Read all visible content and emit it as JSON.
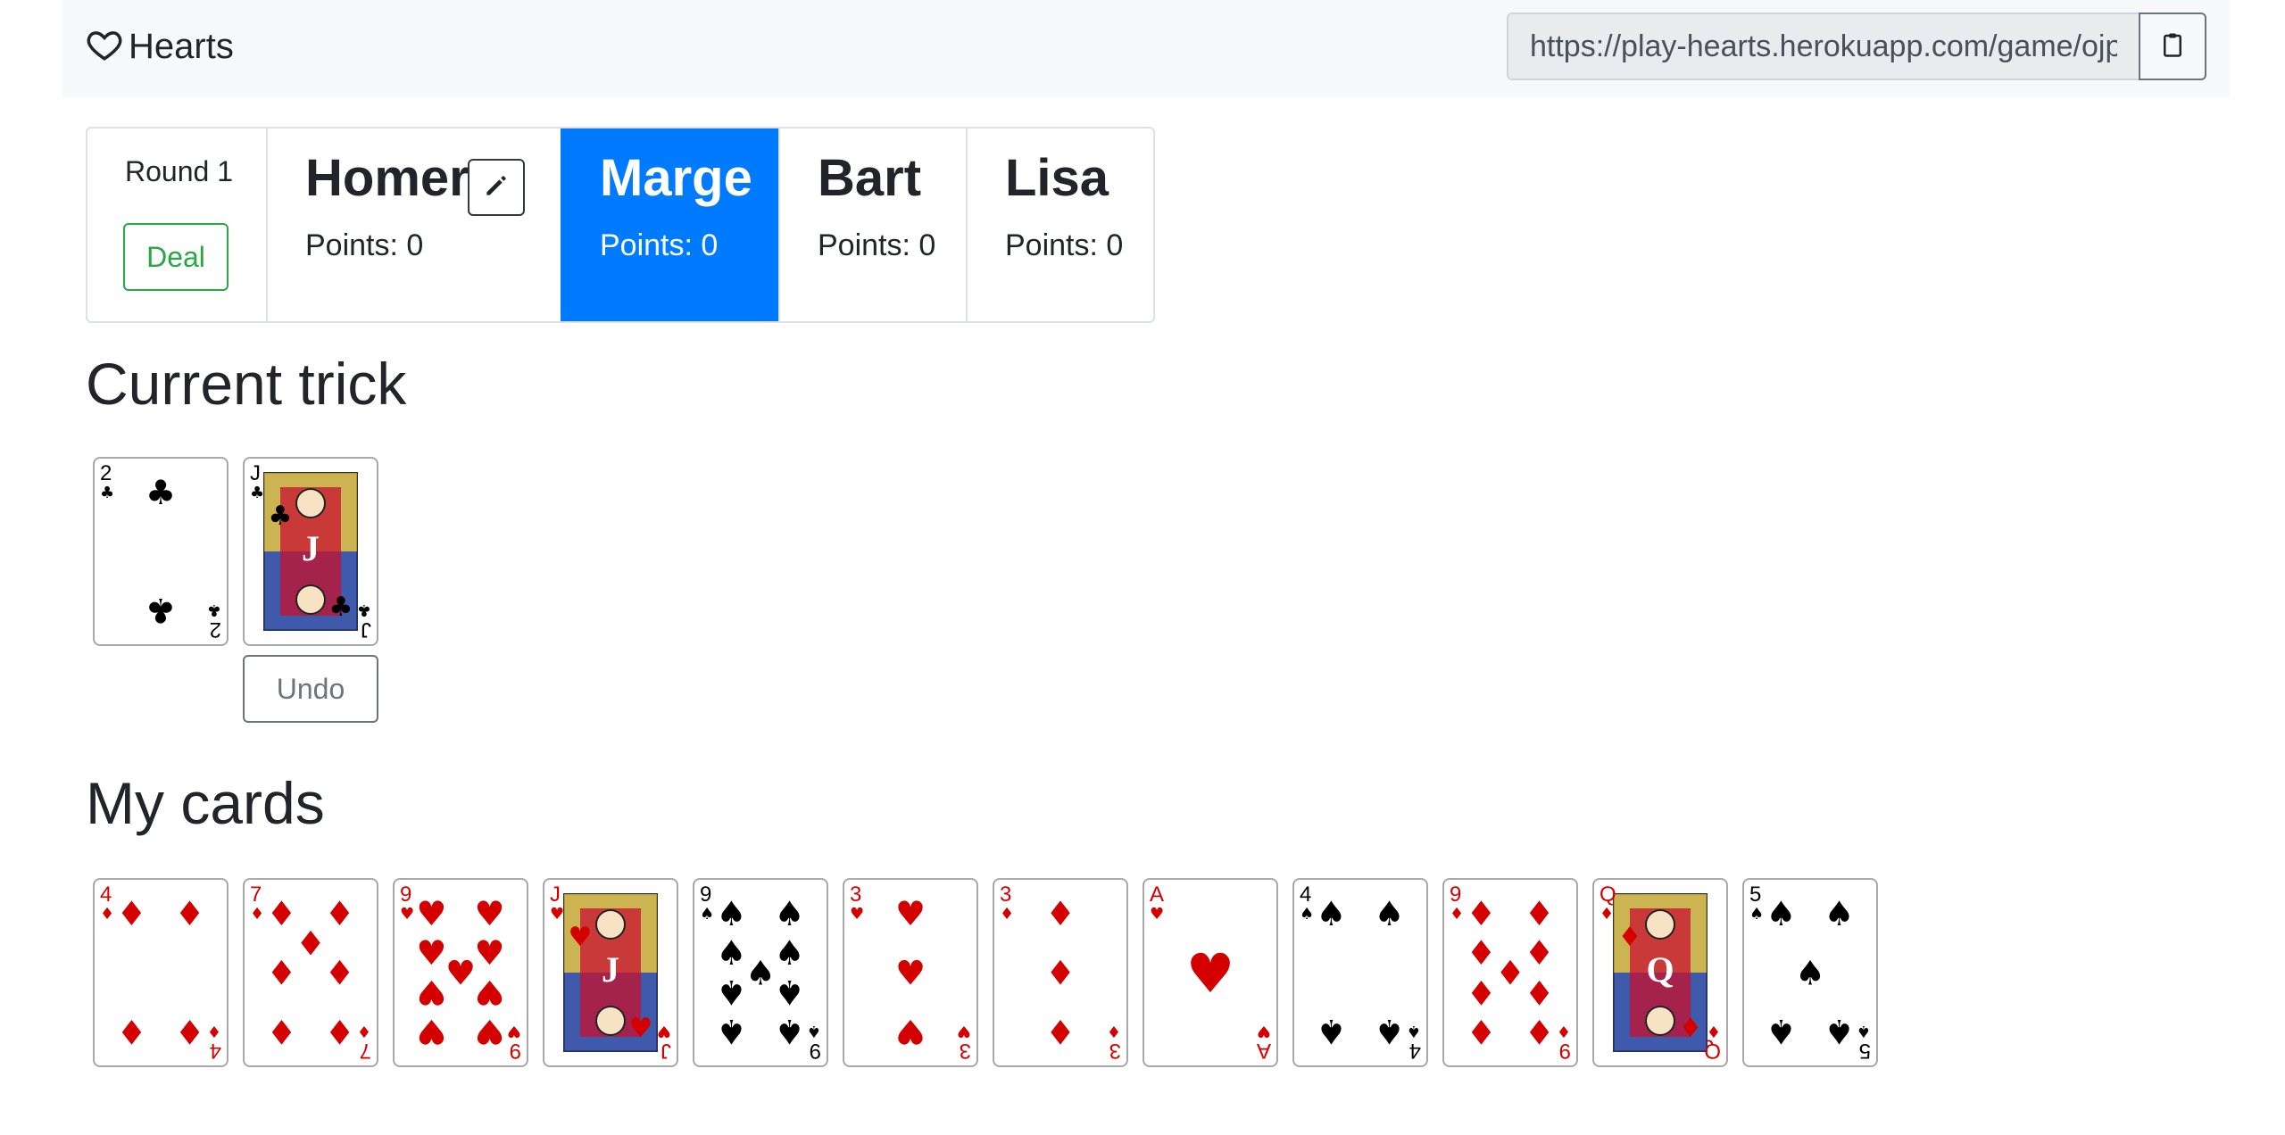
{
  "navbar": {
    "brand": "Hearts",
    "url": "https://play-hearts.herokuapp.com/game/ojp"
  },
  "scoreboard": {
    "round_label": "Round 1",
    "deal_label": "Deal",
    "active_player": "Marge",
    "players": [
      {
        "name": "Homer",
        "points": "Points: 0"
      },
      {
        "name": "Marge",
        "points": "Points: 0"
      },
      {
        "name": "Bart",
        "points": "Points: 0"
      },
      {
        "name": "Lisa",
        "points": "Points: 0"
      }
    ]
  },
  "trick": {
    "heading": "Current trick",
    "undo_label": "Undo",
    "cards": [
      {
        "rank": "2",
        "suit": "clubs"
      },
      {
        "rank": "J",
        "suit": "clubs"
      }
    ]
  },
  "hand": {
    "heading": "My cards",
    "cards": [
      {
        "rank": "4",
        "suit": "diamonds"
      },
      {
        "rank": "7",
        "suit": "diamonds"
      },
      {
        "rank": "9",
        "suit": "hearts"
      },
      {
        "rank": "J",
        "suit": "hearts"
      },
      {
        "rank": "9",
        "suit": "spades"
      },
      {
        "rank": "3",
        "suit": "hearts"
      },
      {
        "rank": "3",
        "suit": "diamonds"
      },
      {
        "rank": "A",
        "suit": "hearts"
      },
      {
        "rank": "4",
        "suit": "spades"
      },
      {
        "rank": "9",
        "suit": "diamonds"
      },
      {
        "rank": "Q",
        "suit": "diamonds"
      },
      {
        "rank": "5",
        "suit": "spades"
      }
    ]
  },
  "colors": {
    "active": "#007bff",
    "deal": "#28a745",
    "red_suit": "#d40000",
    "black_suit": "#000000"
  }
}
